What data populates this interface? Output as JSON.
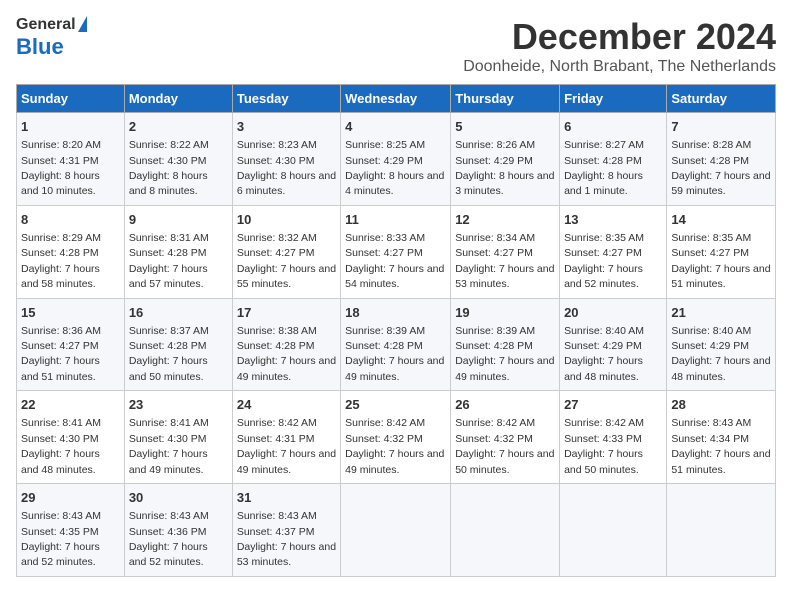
{
  "logo": {
    "general": "General",
    "blue": "Blue"
  },
  "title": "December 2024",
  "location": "Doonheide, North Brabant, The Netherlands",
  "days_of_week": [
    "Sunday",
    "Monday",
    "Tuesday",
    "Wednesday",
    "Thursday",
    "Friday",
    "Saturday"
  ],
  "weeks": [
    [
      {
        "day": "1",
        "sunrise": "Sunrise: 8:20 AM",
        "sunset": "Sunset: 4:31 PM",
        "daylight": "Daylight: 8 hours and 10 minutes."
      },
      {
        "day": "2",
        "sunrise": "Sunrise: 8:22 AM",
        "sunset": "Sunset: 4:30 PM",
        "daylight": "Daylight: 8 hours and 8 minutes."
      },
      {
        "day": "3",
        "sunrise": "Sunrise: 8:23 AM",
        "sunset": "Sunset: 4:30 PM",
        "daylight": "Daylight: 8 hours and 6 minutes."
      },
      {
        "day": "4",
        "sunrise": "Sunrise: 8:25 AM",
        "sunset": "Sunset: 4:29 PM",
        "daylight": "Daylight: 8 hours and 4 minutes."
      },
      {
        "day": "5",
        "sunrise": "Sunrise: 8:26 AM",
        "sunset": "Sunset: 4:29 PM",
        "daylight": "Daylight: 8 hours and 3 minutes."
      },
      {
        "day": "6",
        "sunrise": "Sunrise: 8:27 AM",
        "sunset": "Sunset: 4:28 PM",
        "daylight": "Daylight: 8 hours and 1 minute."
      },
      {
        "day": "7",
        "sunrise": "Sunrise: 8:28 AM",
        "sunset": "Sunset: 4:28 PM",
        "daylight": "Daylight: 7 hours and 59 minutes."
      }
    ],
    [
      {
        "day": "8",
        "sunrise": "Sunrise: 8:29 AM",
        "sunset": "Sunset: 4:28 PM",
        "daylight": "Daylight: 7 hours and 58 minutes."
      },
      {
        "day": "9",
        "sunrise": "Sunrise: 8:31 AM",
        "sunset": "Sunset: 4:28 PM",
        "daylight": "Daylight: 7 hours and 57 minutes."
      },
      {
        "day": "10",
        "sunrise": "Sunrise: 8:32 AM",
        "sunset": "Sunset: 4:27 PM",
        "daylight": "Daylight: 7 hours and 55 minutes."
      },
      {
        "day": "11",
        "sunrise": "Sunrise: 8:33 AM",
        "sunset": "Sunset: 4:27 PM",
        "daylight": "Daylight: 7 hours and 54 minutes."
      },
      {
        "day": "12",
        "sunrise": "Sunrise: 8:34 AM",
        "sunset": "Sunset: 4:27 PM",
        "daylight": "Daylight: 7 hours and 53 minutes."
      },
      {
        "day": "13",
        "sunrise": "Sunrise: 8:35 AM",
        "sunset": "Sunset: 4:27 PM",
        "daylight": "Daylight: 7 hours and 52 minutes."
      },
      {
        "day": "14",
        "sunrise": "Sunrise: 8:35 AM",
        "sunset": "Sunset: 4:27 PM",
        "daylight": "Daylight: 7 hours and 51 minutes."
      }
    ],
    [
      {
        "day": "15",
        "sunrise": "Sunrise: 8:36 AM",
        "sunset": "Sunset: 4:27 PM",
        "daylight": "Daylight: 7 hours and 51 minutes."
      },
      {
        "day": "16",
        "sunrise": "Sunrise: 8:37 AM",
        "sunset": "Sunset: 4:28 PM",
        "daylight": "Daylight: 7 hours and 50 minutes."
      },
      {
        "day": "17",
        "sunrise": "Sunrise: 8:38 AM",
        "sunset": "Sunset: 4:28 PM",
        "daylight": "Daylight: 7 hours and 49 minutes."
      },
      {
        "day": "18",
        "sunrise": "Sunrise: 8:39 AM",
        "sunset": "Sunset: 4:28 PM",
        "daylight": "Daylight: 7 hours and 49 minutes."
      },
      {
        "day": "19",
        "sunrise": "Sunrise: 8:39 AM",
        "sunset": "Sunset: 4:28 PM",
        "daylight": "Daylight: 7 hours and 49 minutes."
      },
      {
        "day": "20",
        "sunrise": "Sunrise: 8:40 AM",
        "sunset": "Sunset: 4:29 PM",
        "daylight": "Daylight: 7 hours and 48 minutes."
      },
      {
        "day": "21",
        "sunrise": "Sunrise: 8:40 AM",
        "sunset": "Sunset: 4:29 PM",
        "daylight": "Daylight: 7 hours and 48 minutes."
      }
    ],
    [
      {
        "day": "22",
        "sunrise": "Sunrise: 8:41 AM",
        "sunset": "Sunset: 4:30 PM",
        "daylight": "Daylight: 7 hours and 48 minutes."
      },
      {
        "day": "23",
        "sunrise": "Sunrise: 8:41 AM",
        "sunset": "Sunset: 4:30 PM",
        "daylight": "Daylight: 7 hours and 49 minutes."
      },
      {
        "day": "24",
        "sunrise": "Sunrise: 8:42 AM",
        "sunset": "Sunset: 4:31 PM",
        "daylight": "Daylight: 7 hours and 49 minutes."
      },
      {
        "day": "25",
        "sunrise": "Sunrise: 8:42 AM",
        "sunset": "Sunset: 4:32 PM",
        "daylight": "Daylight: 7 hours and 49 minutes."
      },
      {
        "day": "26",
        "sunrise": "Sunrise: 8:42 AM",
        "sunset": "Sunset: 4:32 PM",
        "daylight": "Daylight: 7 hours and 50 minutes."
      },
      {
        "day": "27",
        "sunrise": "Sunrise: 8:42 AM",
        "sunset": "Sunset: 4:33 PM",
        "daylight": "Daylight: 7 hours and 50 minutes."
      },
      {
        "day": "28",
        "sunrise": "Sunrise: 8:43 AM",
        "sunset": "Sunset: 4:34 PM",
        "daylight": "Daylight: 7 hours and 51 minutes."
      }
    ],
    [
      {
        "day": "29",
        "sunrise": "Sunrise: 8:43 AM",
        "sunset": "Sunset: 4:35 PM",
        "daylight": "Daylight: 7 hours and 52 minutes."
      },
      {
        "day": "30",
        "sunrise": "Sunrise: 8:43 AM",
        "sunset": "Sunset: 4:36 PM",
        "daylight": "Daylight: 7 hours and 52 minutes."
      },
      {
        "day": "31",
        "sunrise": "Sunrise: 8:43 AM",
        "sunset": "Sunset: 4:37 PM",
        "daylight": "Daylight: 7 hours and 53 minutes."
      },
      null,
      null,
      null,
      null
    ]
  ]
}
